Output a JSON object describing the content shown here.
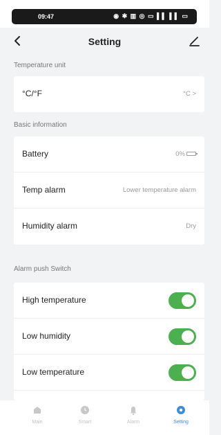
{
  "status_bar": {
    "time": "09:47",
    "icons": "◉ ✱ ▥ ◎ ▭ ▌▌ ▌▌ ▭"
  },
  "header": {
    "title": "Setting"
  },
  "temperature_unit": {
    "header": "Temperature unit",
    "label": "°C/°F",
    "value": "°C >"
  },
  "basic_information": {
    "header": "Basic information",
    "battery": {
      "label": "Battery",
      "value": "0%"
    },
    "temp_alarm": {
      "label": "Temp alarm",
      "value": "Lower temperature alarm"
    },
    "humidity_alarm": {
      "label": "Humidity alarm",
      "value": "Dry"
    }
  },
  "alarm_push": {
    "header": "Alarm push Switch",
    "items": [
      {
        "label": "High temperature",
        "on": true
      },
      {
        "label": "Low humidity",
        "on": true
      },
      {
        "label": "Low temperature",
        "on": true
      }
    ]
  },
  "tabs": [
    {
      "label": "Main",
      "icon": "home-icon",
      "active": false
    },
    {
      "label": "Smart",
      "icon": "clock-icon",
      "active": false
    },
    {
      "label": "Alarm",
      "icon": "bell-icon",
      "active": false
    },
    {
      "label": "Setting",
      "icon": "gear-icon",
      "active": true
    }
  ],
  "colors": {
    "toggle_on": "#4caf50",
    "tab_active": "#3a8dde",
    "tab_inactive": "#c2c2c2"
  }
}
